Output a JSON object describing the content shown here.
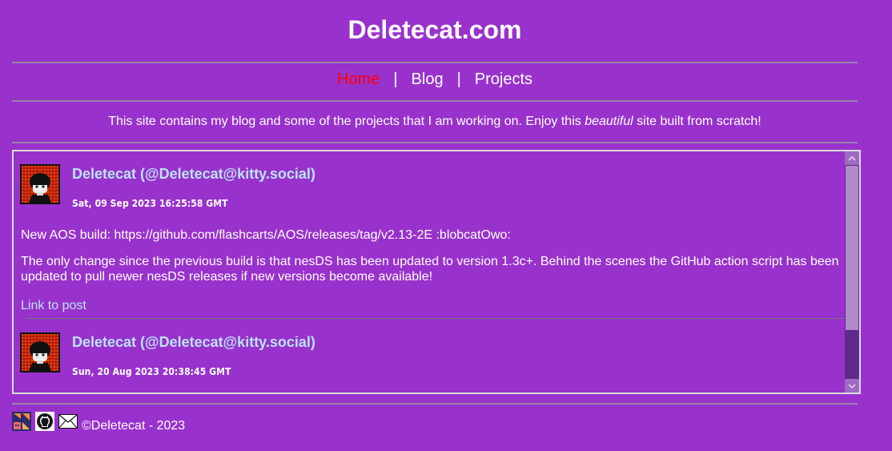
{
  "site": {
    "title": "Deletecat.com"
  },
  "nav": {
    "items": [
      {
        "label": "Home",
        "active": true
      },
      {
        "label": "Blog",
        "active": false
      },
      {
        "label": "Projects",
        "active": false
      }
    ],
    "separator": "|"
  },
  "intro": {
    "before": "This site contains my blog and some of the projects that I am working on. Enjoy this ",
    "emphasis": "beautiful",
    "after": " site built from scratch!"
  },
  "feed": {
    "posts": [
      {
        "author": "Deletecat (@Deletecat@kitty.social)",
        "date": "Sat, 09 Sep 2023 16:25:58 GMT",
        "paragraphs": [
          "New AOS build: https://github.com/flashcarts/AOS/releases/tag/v2.13-2E :blobcatOwo:",
          "The only change since the previous build is that nesDS has been updated to version 1.3c+. Behind the scenes the GitHub action script has been updated to pull newer nesDS releases if new versions become available!"
        ],
        "link_label": "Link to post"
      },
      {
        "author": "Deletecat (@Deletecat@kitty.social)",
        "date": "Sun, 20 Aug 2023 20:38:45 GMT"
      }
    ]
  },
  "footer": {
    "icons": [
      "kitty-social-icon",
      "github-icon",
      "email-icon"
    ],
    "copyright": "©Deletecat - 2023"
  },
  "colors": {
    "background": "#9932cc",
    "link": "#b8e4f5",
    "active_nav": "#ff0000"
  }
}
